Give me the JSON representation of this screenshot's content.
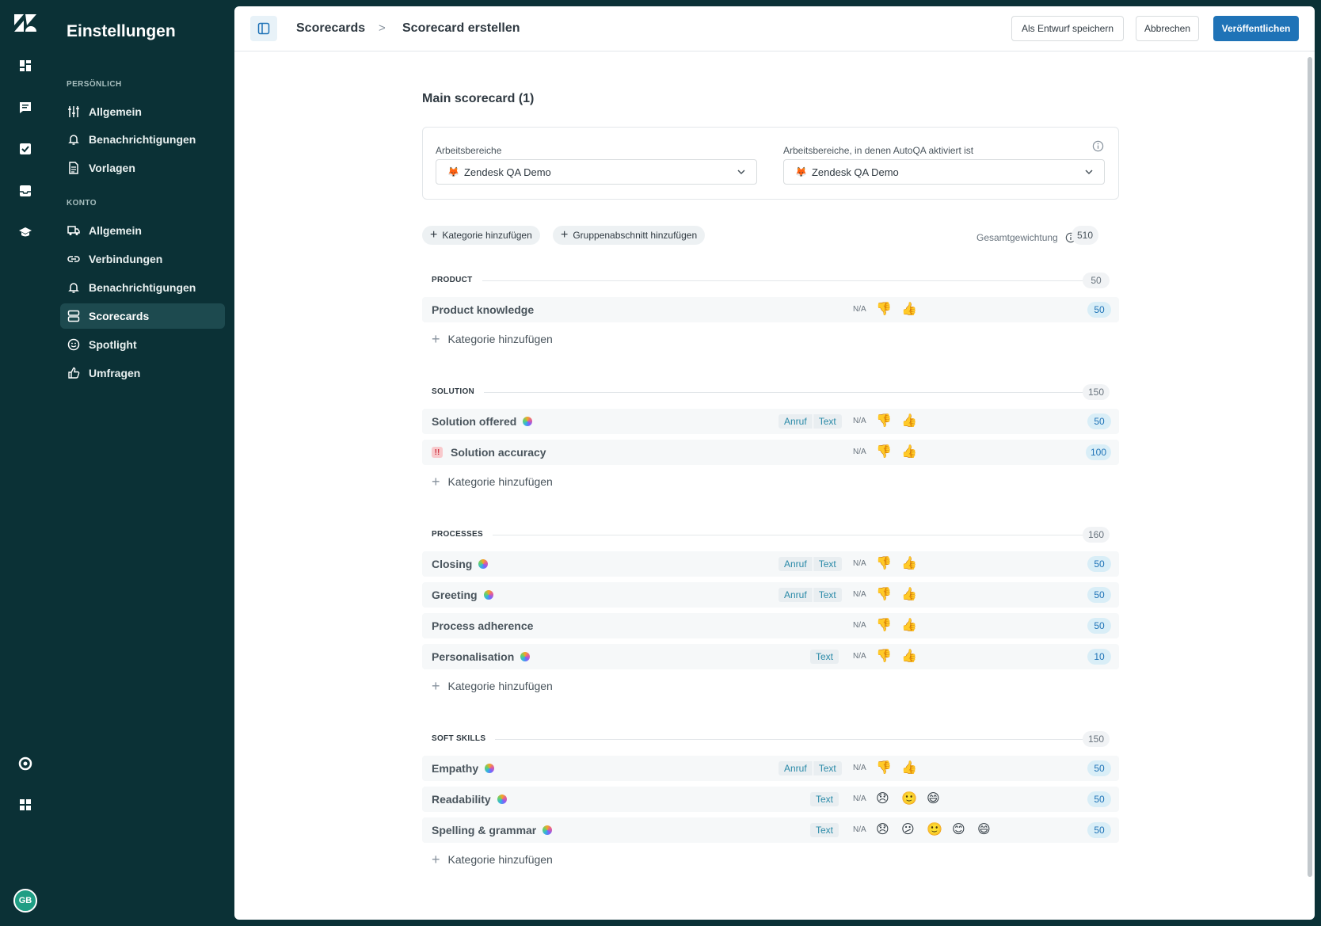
{
  "rail": {
    "icons": [
      "zendesk-logo",
      "dashboard-icon",
      "conversations-icon",
      "tasks-icon",
      "inbox-icon",
      "coaching-icon",
      "help-icon",
      "apps-icon"
    ],
    "avatar_initials": "GB"
  },
  "sidebar": {
    "title": "Einstellungen",
    "sections": [
      {
        "label": "PERSÖNLICH",
        "items": [
          {
            "label": "Allgemein",
            "icon": "sliders-icon"
          },
          {
            "label": "Benachrichtigungen",
            "icon": "bell-icon"
          },
          {
            "label": "Vorlagen",
            "icon": "document-icon"
          }
        ]
      },
      {
        "label": "KONTO",
        "items": [
          {
            "label": "Allgemein",
            "icon": "truck-icon"
          },
          {
            "label": "Verbindungen",
            "icon": "link-icon"
          },
          {
            "label": "Benachrichtigungen",
            "icon": "bell-icon"
          },
          {
            "label": "Scorecards",
            "icon": "scorecard-icon",
            "active": true
          },
          {
            "label": "Spotlight",
            "icon": "smiley-icon"
          },
          {
            "label": "Umfragen",
            "icon": "thumbs-up-icon"
          }
        ]
      }
    ]
  },
  "topbar": {
    "breadcrumb_parent": "Scorecards",
    "breadcrumb_separator": ">",
    "breadcrumb_current": "Scorecard erstellen",
    "save_draft_label": "Als Entwurf speichern",
    "cancel_label": "Abbrechen",
    "publish_label": "Veröffentlichen"
  },
  "scorecard": {
    "title": "Main scorecard (1)",
    "workspaces_label": "Arbeitsbereiche",
    "workspaces_value": "Zendesk QA Demo",
    "autoqa_label": "Arbeitsbereiche, in denen AutoQA aktiviert ist",
    "autoqa_value": "Zendesk QA Demo",
    "add_category_label": "Kategorie hinzufügen",
    "add_group_label": "Gruppenabschnitt hinzufügen",
    "total_weight_label": "Gesamtgewichtung",
    "total_weight_value": "510",
    "na_label": "N/A",
    "tag_call": "Anruf",
    "tag_text": "Text",
    "add_category_row_label": "Kategorie hinzufügen",
    "groups": [
      {
        "name": "PRODUCT",
        "weight": "50",
        "categories": [
          {
            "name": "Product knowledge",
            "tags": [],
            "rating": "binary",
            "weight": "50",
            "autoqa": false,
            "critical": false
          }
        ]
      },
      {
        "name": "SOLUTION",
        "weight": "150",
        "categories": [
          {
            "name": "Solution offered",
            "tags": [
              "call",
              "text"
            ],
            "rating": "binary",
            "weight": "50",
            "autoqa": true,
            "critical": false
          },
          {
            "name": "Solution accuracy",
            "tags": [],
            "rating": "binary",
            "weight": "100",
            "autoqa": false,
            "critical": true
          }
        ]
      },
      {
        "name": "PROCESSES",
        "weight": "160",
        "categories": [
          {
            "name": "Closing",
            "tags": [
              "call",
              "text"
            ],
            "rating": "binary",
            "weight": "50",
            "autoqa": true,
            "critical": false
          },
          {
            "name": "Greeting",
            "tags": [
              "call",
              "text"
            ],
            "rating": "binary",
            "weight": "50",
            "autoqa": true,
            "critical": false
          },
          {
            "name": "Process adherence",
            "tags": [],
            "rating": "binary",
            "weight": "50",
            "autoqa": false,
            "critical": false
          },
          {
            "name": "Personalisation",
            "tags": [
              "text"
            ],
            "rating": "binary",
            "weight": "10",
            "autoqa": true,
            "critical": false
          }
        ]
      },
      {
        "name": "SOFT SKILLS",
        "weight": "150",
        "categories": [
          {
            "name": "Empathy",
            "tags": [
              "call",
              "text"
            ],
            "rating": "binary",
            "weight": "50",
            "autoqa": true,
            "critical": false
          },
          {
            "name": "Readability",
            "tags": [
              "text"
            ],
            "rating": "three",
            "weight": "50",
            "autoqa": true,
            "critical": false
          },
          {
            "name": "Spelling & grammar",
            "tags": [
              "text"
            ],
            "rating": "five",
            "weight": "50",
            "autoqa": true,
            "critical": false
          }
        ]
      }
    ]
  },
  "colors": {
    "sidebar_bg": "#0b3136",
    "active_item_bg": "#1d4a4f",
    "primary": "#1f73b7",
    "weight_pill_bg": "#d9eef7"
  }
}
